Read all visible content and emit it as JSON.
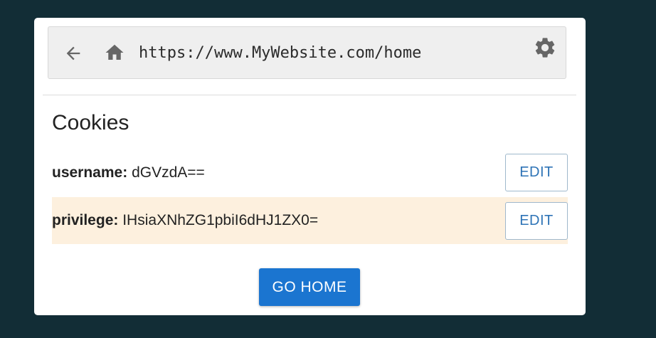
{
  "browser": {
    "url": "https://www.MyWebsite.com/home",
    "back_icon": "arrow-left",
    "home_icon": "home",
    "settings_icon": "gear"
  },
  "cookies_panel": {
    "title": "Cookies",
    "items": [
      {
        "key": "username:",
        "value": "dGVzdA==",
        "edit_label": "EDIT"
      },
      {
        "key": "privilege:",
        "value": "IHsiaXNhZG1pbiI6dHJ1ZX0=",
        "edit_label": "EDIT"
      }
    ]
  },
  "actions": {
    "go_home_label": "GO HOME"
  },
  "colors": {
    "page_background": "#122d36",
    "accent": "#1b75d0",
    "highlight_row": "#fdf0de"
  }
}
